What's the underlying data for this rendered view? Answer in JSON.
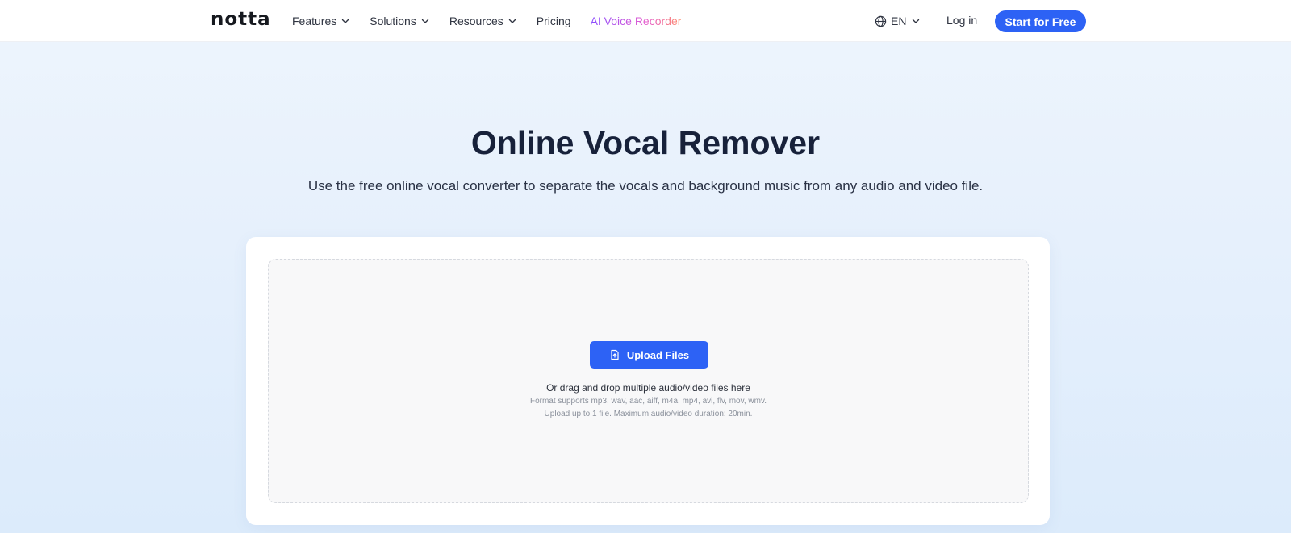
{
  "header": {
    "logo_text": "notta",
    "nav": [
      {
        "label": "Features",
        "has_dropdown": true
      },
      {
        "label": "Solutions",
        "has_dropdown": true
      },
      {
        "label": "Resources",
        "has_dropdown": true
      },
      {
        "label": "Pricing",
        "has_dropdown": false
      },
      {
        "label": "AI Voice Recorder",
        "has_dropdown": false,
        "highlight": true
      }
    ],
    "language": "EN",
    "login_label": "Log in",
    "start_label": "Start for Free"
  },
  "hero": {
    "title": "Online Vocal Remover",
    "subtitle": "Use the free online vocal converter to separate the vocals and background music from any audio and video file."
  },
  "upload": {
    "button_label": "Upload Files",
    "drop_text": "Or drag and drop multiple audio/video files here",
    "format_text": "Format supports mp3, wav, aac, aiff, m4a, mp4, avi, flv, mov, wmv.",
    "limit_text": "Upload up to 1 file. Maximum audio/video duration: 20min."
  },
  "colors": {
    "accent": "#2d62f5",
    "highlight_gradient_start": "#8a4dff",
    "highlight_gradient_end": "#ff8a6a",
    "page_bg": "#e6f0fc"
  },
  "icons": {
    "nav_dropdown": "chevron-down-icon",
    "language": "globe-icon",
    "upload": "file-upload-icon"
  }
}
